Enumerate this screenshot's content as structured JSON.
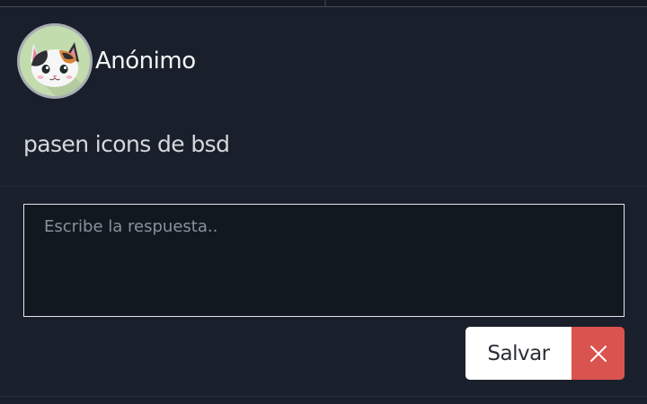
{
  "post": {
    "author": "Anónimo",
    "text": "pasen icons de bsd",
    "avatar_icon": "calico-cat-avatar"
  },
  "reply": {
    "placeholder": "Escribe la respuesta..",
    "value": ""
  },
  "actions": {
    "save_label": "Salvar",
    "close_icon": "close-x-icon"
  },
  "colors": {
    "background": "#1a202b",
    "input_background": "#111820",
    "avatar_background": "#c3dcae",
    "save_button": "#ffffff",
    "close_button": "#d9534f"
  }
}
